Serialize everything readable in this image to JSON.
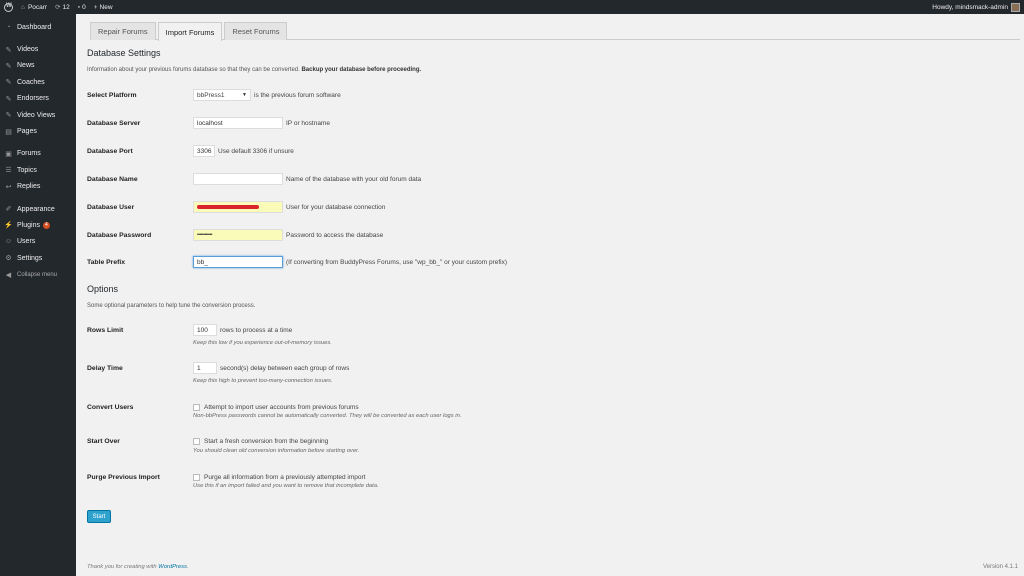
{
  "adminbar": {
    "site_name": "Pocarr",
    "updates_count": "12",
    "comments_count": "0",
    "new_label": "New",
    "greeting": "Howdy, mindsmack-admin"
  },
  "sidebar": {
    "items": [
      {
        "label": "Dashboard",
        "icon": "dashboard-icon"
      },
      {
        "label": "Videos",
        "icon": "pin-icon"
      },
      {
        "label": "News",
        "icon": "pin-icon"
      },
      {
        "label": "Coaches",
        "icon": "pin-icon"
      },
      {
        "label": "Endorsers",
        "icon": "pin-icon"
      },
      {
        "label": "Video Views",
        "icon": "pin-icon"
      },
      {
        "label": "Pages",
        "icon": "page-icon"
      },
      {
        "label": "Forums",
        "icon": "forum-icon"
      },
      {
        "label": "Topics",
        "icon": "topics-icon"
      },
      {
        "label": "Replies",
        "icon": "replies-icon"
      },
      {
        "label": "Appearance",
        "icon": "brush-icon"
      },
      {
        "label": "Plugins",
        "icon": "plug-icon",
        "badge": "4"
      },
      {
        "label": "Users",
        "icon": "users-icon"
      },
      {
        "label": "Settings",
        "icon": "settings-icon"
      }
    ],
    "collapse_label": "Collapse menu"
  },
  "tabs": [
    "Repair Forums",
    "Import Forums",
    "Reset Forums"
  ],
  "db": {
    "title": "Database Settings",
    "desc": "Information about your previous forums database so that they can be converted. ",
    "desc_bold": "Backup your database before proceeding.",
    "platform_label": "Select Platform",
    "platform_value": "bbPress1",
    "platform_desc": "is the previous forum software",
    "server_label": "Database Server",
    "server_value": "localhost",
    "server_desc": "IP or hostname",
    "port_label": "Database Port",
    "port_value": "3306",
    "port_desc": "Use default 3306 if unsure",
    "name_label": "Database Name",
    "name_value": "",
    "name_desc": "Name of the database with your old forum data",
    "user_label": "Database User",
    "user_desc": "User for your database connection",
    "password_label": "Database Password",
    "password_value": "••••••••••••",
    "password_desc": "Password to access the database",
    "prefix_label": "Table Prefix",
    "prefix_value": "bb_",
    "prefix_desc": "(If converting from BuddyPress Forums, use \"wp_bb_\" or your custom prefix)"
  },
  "options": {
    "title": "Options",
    "desc": "Some optional parameters to help tune the conversion process.",
    "rows_label": "Rows Limit",
    "rows_value": "100",
    "rows_desc": "rows to process at a time",
    "rows_hint": "Keep this low if you experience out-of-memory issues.",
    "delay_label": "Delay Time",
    "delay_value": "1",
    "delay_desc": "second(s) delay between each group of rows",
    "delay_hint": "Keep this high to prevent too-many-connection issues.",
    "convert_label": "Convert Users",
    "convert_desc": "Attempt to import user accounts from previous forums",
    "convert_hint": "Non-bbPress passwords cannot be automatically converted. They will be converted as each user logs in.",
    "startover_label": "Start Over",
    "startover_desc": "Start a fresh conversion from the beginning",
    "startover_hint": "You should clean old conversion information before starting over.",
    "purge_label": "Purge Previous Import",
    "purge_desc": "Purge all information from a previously attempted import",
    "purge_hint": "Use this if an import failed and you want to remove that incomplete data."
  },
  "start_label": "Start",
  "footer": {
    "thanks_prefix": "Thank you for creating with ",
    "thanks_link": "WordPress",
    "thanks_suffix": ".",
    "version": "Version 4.1.1"
  }
}
